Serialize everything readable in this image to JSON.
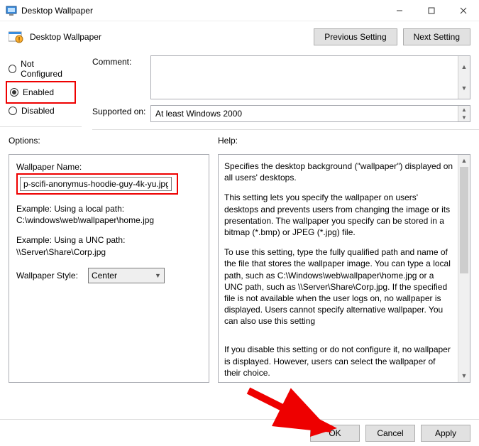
{
  "window": {
    "title": "Desktop Wallpaper"
  },
  "header": {
    "title": "Desktop Wallpaper",
    "prev_btn": "Previous Setting",
    "next_btn": "Next Setting"
  },
  "state": {
    "not_configured": "Not Configured",
    "enabled": "Enabled",
    "disabled": "Disabled",
    "selected": "enabled"
  },
  "form": {
    "comment_label": "Comment:",
    "supported_label": "Supported on:",
    "supported_value": "At least Windows 2000"
  },
  "columns": {
    "options_label": "Options:",
    "help_label": "Help:"
  },
  "options": {
    "wallpaper_name_label": "Wallpaper Name:",
    "wallpaper_name_value": "p-scifi-anonymus-hoodie-guy-4k-yu.jpg",
    "example_local_label": "Example: Using a local path:",
    "example_local_value": "C:\\windows\\web\\wallpaper\\home.jpg",
    "example_unc_label": "Example: Using a UNC path:",
    "example_unc_value": "\\\\Server\\Share\\Corp.jpg",
    "style_label": "Wallpaper Style:",
    "style_value": "Center"
  },
  "help": {
    "p1": "Specifies the desktop background (\"wallpaper\") displayed on all users' desktops.",
    "p2": "This setting lets you specify the wallpaper on users' desktops and prevents users from changing the image or its presentation. The wallpaper you specify can be stored in a bitmap (*.bmp) or JPEG (*.jpg) file.",
    "p3": "To use this setting, type the fully qualified path and name of the file that stores the wallpaper image. You can type a local path, such as C:\\Windows\\web\\wallpaper\\home.jpg or a UNC path, such as \\\\Server\\Share\\Corp.jpg. If the specified file is not available when the user logs on, no wallpaper is displayed. Users cannot specify alternative wallpaper. You can also use this setting",
    "p4": "If you disable this setting or do not configure it, no wallpaper is displayed. However, users can select the wallpaper of their choice."
  },
  "footer": {
    "ok": "OK",
    "cancel": "Cancel",
    "apply": "Apply"
  }
}
